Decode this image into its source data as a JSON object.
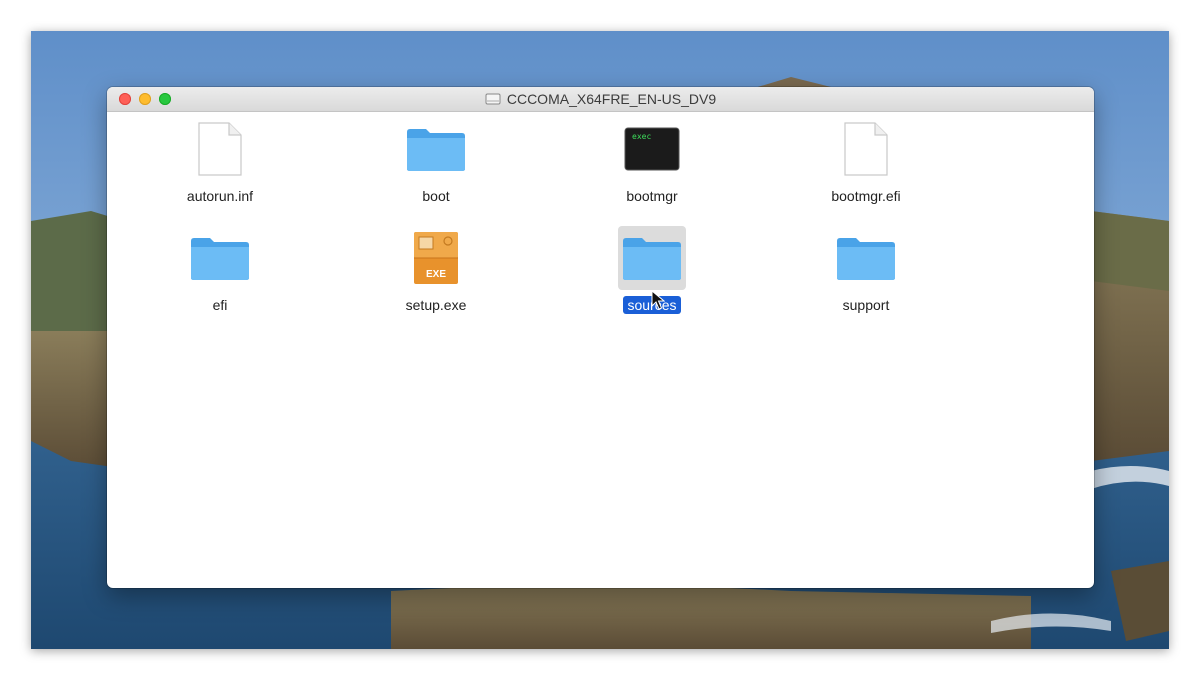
{
  "window": {
    "title": "CCCOMA_X64FRE_EN-US_DV9"
  },
  "items": [
    {
      "name": "autorun.inf",
      "icon": "document-icon"
    },
    {
      "name": "boot",
      "icon": "folder-icon"
    },
    {
      "name": "bootmgr",
      "icon": "exec-icon",
      "icon_text": "exec"
    },
    {
      "name": "bootmgr.efi",
      "icon": "document-icon"
    },
    {
      "name": "efi",
      "icon": "folder-icon"
    },
    {
      "name": "setup.exe",
      "icon": "exe-icon",
      "icon_text": "EXE"
    },
    {
      "name": "sources",
      "icon": "folder-icon",
      "selected": true
    },
    {
      "name": "support",
      "icon": "folder-icon"
    }
  ],
  "colors": {
    "folder": "#62b6f2",
    "selection": "#1a5fd7",
    "exe_orange": "#e8922c"
  }
}
